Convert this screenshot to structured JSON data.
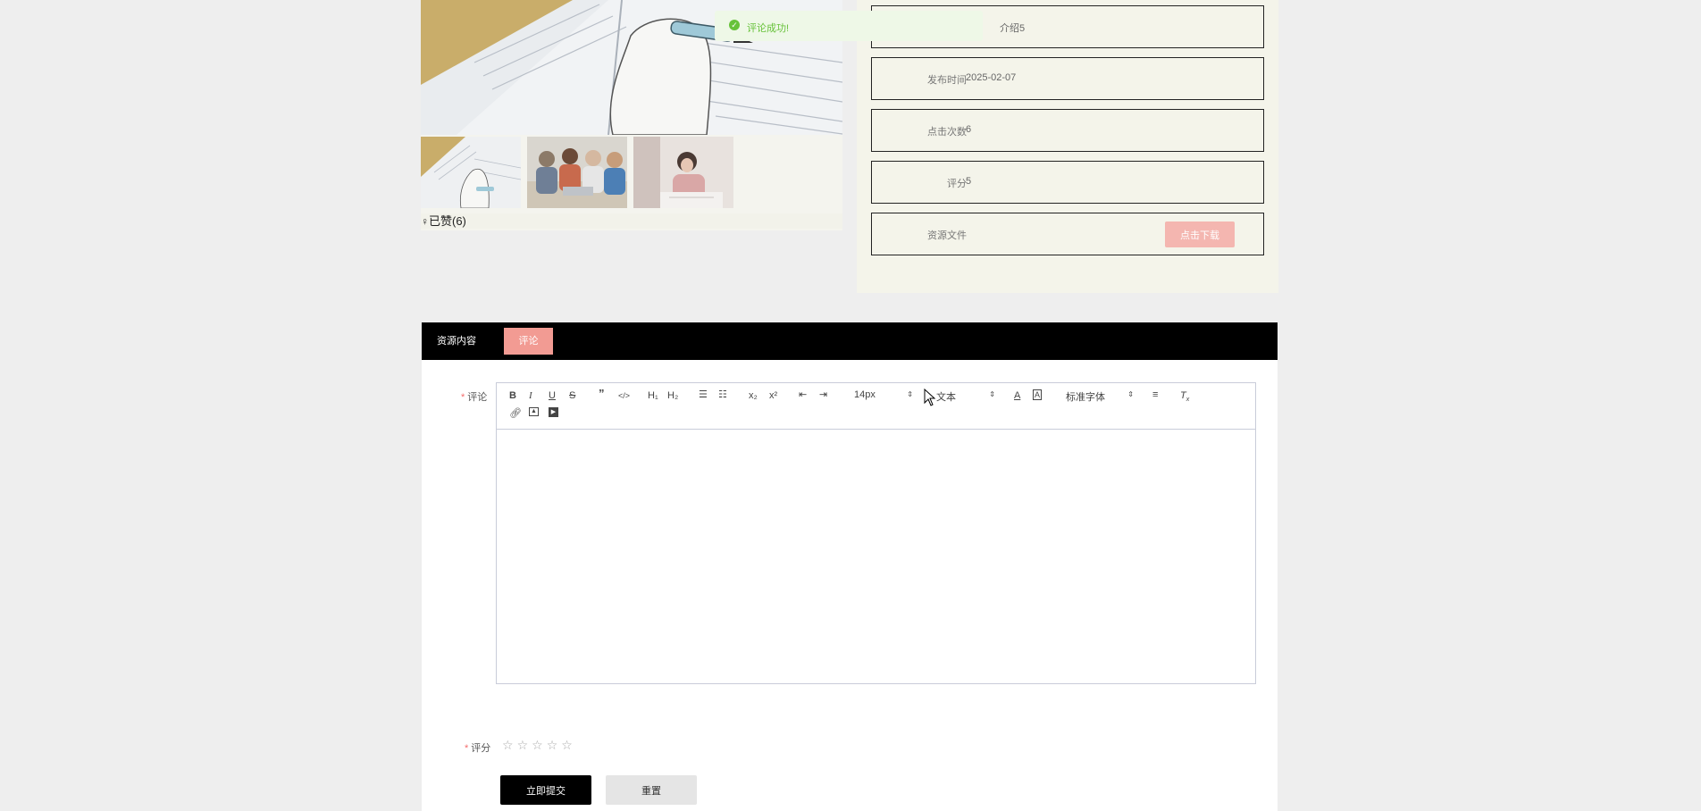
{
  "toast": {
    "message": "评论成功!"
  },
  "gallery": {
    "like_label": "已赞(6)",
    "like_icon": "pin-icon"
  },
  "info": {
    "intro_value": "介绍5",
    "rows": [
      {
        "label": "发布时间",
        "value": "2025-02-07"
      },
      {
        "label": "点击次数",
        "value": "6"
      },
      {
        "label": "评分",
        "value": "5"
      },
      {
        "label": "资源文件",
        "value": ""
      }
    ],
    "download_label": "点击下载"
  },
  "tabs": [
    {
      "label": "资源内容",
      "active": false
    },
    {
      "label": "评论",
      "active": true
    }
  ],
  "form": {
    "comment_label": "评论",
    "rating_label": "评分",
    "required_mark": "*",
    "rating_stars": 5,
    "rating_value": 0,
    "submit_label": "立即提交",
    "reset_label": "重置"
  },
  "toolbar": {
    "font_size": "14px",
    "header_select": "文本",
    "font_family": "标准字体",
    "heading1": "H₁",
    "heading2": "H₂",
    "subscript": "x₂",
    "superscript": "x²"
  },
  "colors": {
    "accent": "#f29b93",
    "download": "#f4b6b0",
    "success": "#67c23a",
    "tab_bar": "#000000"
  }
}
